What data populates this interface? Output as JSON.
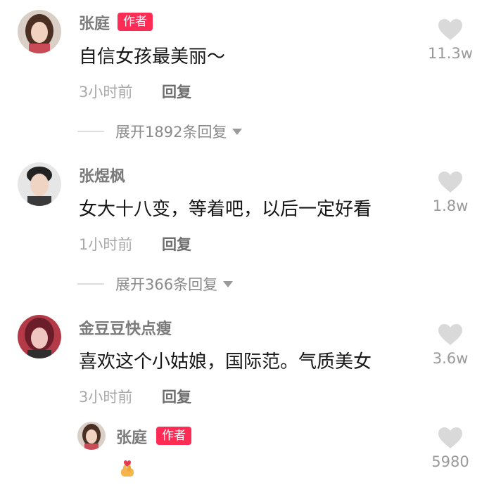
{
  "comments": [
    {
      "name": "张庭",
      "badge": "作者",
      "text": "自信女孩最美丽～",
      "time": "3小时前",
      "reply": "回复",
      "likes": "11.3w",
      "expand": "展开1892条回复"
    },
    {
      "name": "张煜枫",
      "text": "女大十八变，等着吧，以后一定好看",
      "time": "1小时前",
      "reply": "回复",
      "likes": "1.8w",
      "expand": "展开366条回复"
    },
    {
      "name": "金豆豆快点瘦",
      "text": "喜欢这个小姑娘，国际范。气质美女",
      "time": "3小时前",
      "reply": "回复",
      "likes": "3.6w"
    }
  ],
  "sub_reply": {
    "name": "张庭",
    "badge": "作者",
    "emoji": "finger-heart-icon",
    "likes": "5980"
  },
  "colors": {
    "badge": "#fe2c55",
    "heart": "#d9d9d9",
    "name": "#7a7a7a"
  }
}
